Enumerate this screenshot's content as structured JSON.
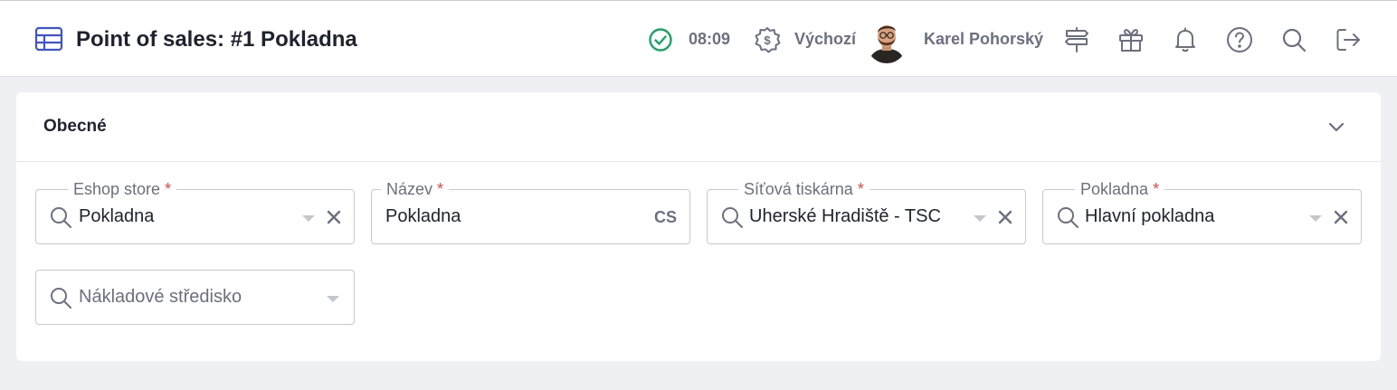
{
  "header": {
    "app_icon": "table-icon",
    "title": "Point of sales: #1 Pokladna",
    "status_icon": "check-circle-icon",
    "status_color": "#1aa566",
    "time": "08:09",
    "currency_icon": "currency-gear-icon",
    "currency_label": "Výchozí",
    "user_name": "Karel Pohorský",
    "icons": [
      "signpost-icon",
      "gift-icon",
      "bell-icon",
      "help-icon",
      "search-icon",
      "logout-icon"
    ]
  },
  "section": {
    "title": "Obecné",
    "toggle_icon": "chevron-down-icon"
  },
  "form": {
    "eshop_store": {
      "label": "Eshop store",
      "required_mark": "*",
      "value": "Pokladna"
    },
    "name": {
      "label": "Název",
      "required_mark": "*",
      "value": "Pokladna",
      "language": "CS"
    },
    "network_printer": {
      "label": "Síťová tiskárna",
      "required_mark": "*",
      "value": "Uherské Hradiště - TSC"
    },
    "cash_register": {
      "label": "Pokladna",
      "required_mark": "*",
      "value": "Hlavní pokladna"
    },
    "cost_center": {
      "placeholder": "Nákladové středisko"
    }
  },
  "colors": {
    "accent": "#3d52d5",
    "label": "#6b7080",
    "required": "#e04848",
    "background": "#eef0f4"
  }
}
